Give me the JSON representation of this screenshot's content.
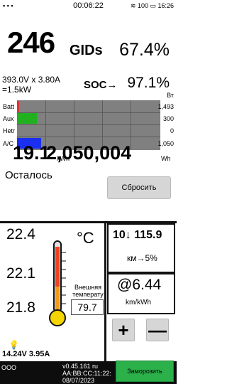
{
  "statusbar": {
    "left": "▪ ▪ ▪",
    "timer": "00:06:22",
    "right": "≋ 100 ▭ 16:26"
  },
  "battery": {
    "gids": "246",
    "gids_unit": "GIDs",
    "percent": "67.4%",
    "voltage_current": "393.0V x 3.80A",
    "power": "=1.5kW",
    "soc_label": "SOC→",
    "soc_value": "97.1%"
  },
  "power_chart": {
    "labels": [
      "Batt",
      "Aux",
      "Hetr",
      "A/C"
    ],
    "unit": "Вт",
    "values": [
      "1,493",
      "300",
      "0",
      "1,050"
    ],
    "fills": [
      0.015,
      0.14,
      0.0,
      0.17
    ],
    "colors": [
      "#e03030",
      "#20b020",
      "#808080",
      "#1a2ff0"
    ]
  },
  "energy": {
    "remaining_kwh": "19.1",
    "left_unit": "kWh",
    "total_wh": "2,050,004",
    "right_unit": "Wh",
    "remain_label": "Осталось",
    "reset_label": "Сбросить"
  },
  "temps": {
    "t1": "22.4",
    "t2": "22.1",
    "t3": "21.8",
    "unit": "°C",
    "ext_label": "Внешняя температу",
    "ext_value": "79.7"
  },
  "range": {
    "value": "10↓ 115.9",
    "unit": "км→5%"
  },
  "efficiency": {
    "value": "@6.44",
    "unit": "km/kWh"
  },
  "controls": {
    "plus": "+",
    "minus": "—",
    "freeze": "Заморозить"
  },
  "aux": {
    "bulb": "💡",
    "value": "14.24V 3.95A"
  },
  "bottom": {
    "left": "OOO",
    "version": "v0.45.161 ru",
    "mac": "AA:BB:CC:11:22:",
    "date": "08/07/2023"
  }
}
